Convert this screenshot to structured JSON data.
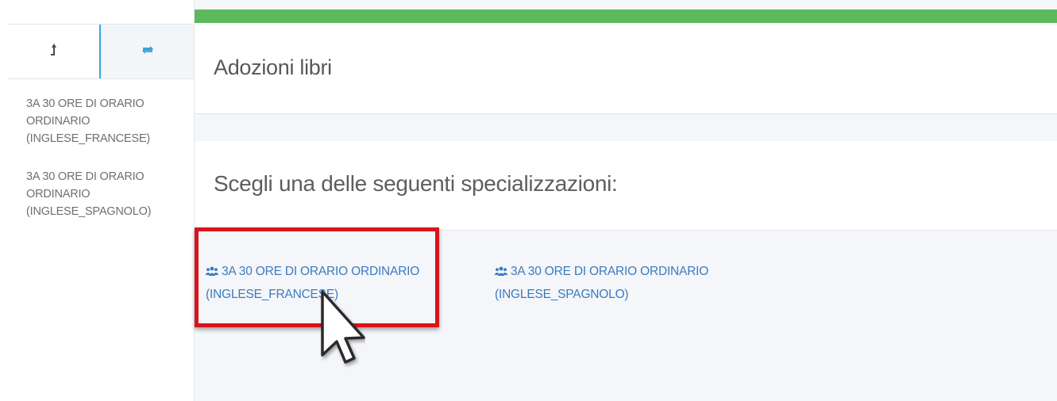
{
  "sidebar": {
    "tabs": [
      {
        "icon": "upload-arrow-icon"
      },
      {
        "icon": "refresh-icon",
        "color": "#3aa4d8"
      }
    ],
    "items": [
      {
        "label": "3A 30 ORE DI ORARIO ORDINARIO (INGLESE_FRANCESE)"
      },
      {
        "label": "3A 30 ORE DI ORARIO ORDINARIO (INGLESE_SPAGNOLO)"
      }
    ]
  },
  "header": {
    "title": "Adozioni libri",
    "accent_color": "#5cb85c"
  },
  "main": {
    "heading": "Scegli una delle seguenti specializzazioni:",
    "options": [
      {
        "icon": "group-icon",
        "label": "3A 30 ORE DI ORARIO ORDINARIO (INGLESE_FRANCESE)"
      },
      {
        "icon": "group-icon",
        "label": "3A 30 ORE DI ORARIO ORDINARIO (INGLESE_SPAGNOLO)"
      }
    ],
    "link_color": "#3b7bbf",
    "highlight_color": "#d9141b"
  }
}
